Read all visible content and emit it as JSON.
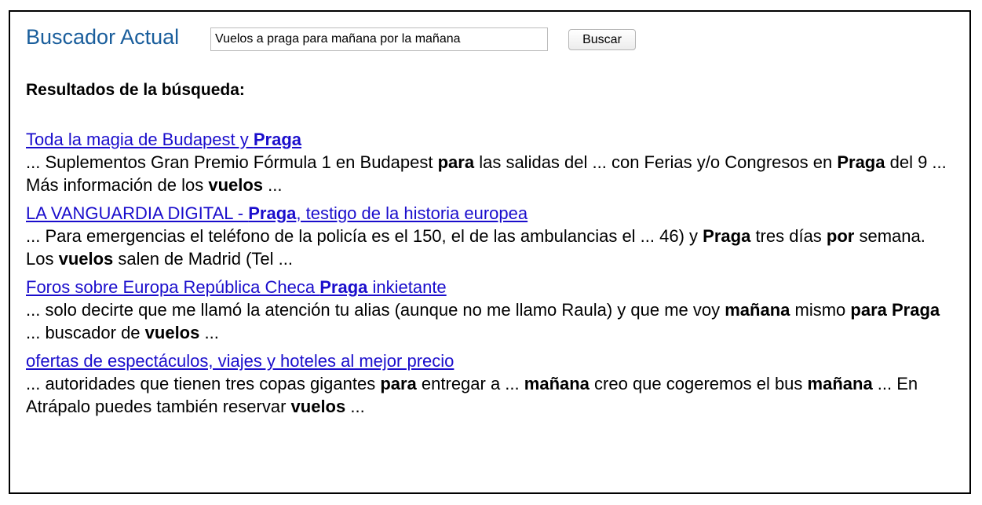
{
  "header": {
    "brand": "Buscador Actual",
    "search_value": "Vuelos a praga para mañana por la mañana",
    "search_button": "Buscar"
  },
  "results_heading": "Resultados de la búsqueda:",
  "results": [
    {
      "title": [
        {
          "text": "Toda la magia de Budapest y ",
          "bold": false
        },
        {
          "text": "Praga",
          "bold": true
        }
      ],
      "snippet": [
        {
          "text": "... Suplementos Gran Premio Fórmula 1 en Budapest ",
          "bold": false
        },
        {
          "text": "para",
          "bold": true
        },
        {
          "text": " las salidas del ... con Ferias y/o Congresos en ",
          "bold": false
        },
        {
          "text": "Praga",
          "bold": true
        },
        {
          "text": " del 9 ... Más información de los ",
          "bold": false
        },
        {
          "text": "vuelos",
          "bold": true
        },
        {
          "text": " ...",
          "bold": false
        }
      ]
    },
    {
      "title": [
        {
          "text": "LA VANGUARDIA DIGITAL - ",
          "bold": false
        },
        {
          "text": "Praga",
          "bold": true
        },
        {
          "text": ", testigo de la historia europea",
          "bold": false
        }
      ],
      "snippet": [
        {
          "text": "... Para emergencias el teléfono de la policía es el 150, el de las ambulancias el ... 46) y ",
          "bold": false
        },
        {
          "text": "Praga",
          "bold": true
        },
        {
          "text": " tres días ",
          "bold": false
        },
        {
          "text": "por",
          "bold": true
        },
        {
          "text": " semana. Los ",
          "bold": false
        },
        {
          "text": "vuelos",
          "bold": true
        },
        {
          "text": " salen de Madrid (Tel ...",
          "bold": false
        }
      ]
    },
    {
      "title": [
        {
          "text": "Foros sobre Europa República Checa ",
          "bold": false
        },
        {
          "text": "Praga",
          "bold": true
        },
        {
          "text": " inkietante",
          "bold": false
        }
      ],
      "snippet": [
        {
          "text": "... solo decirte que me llamó la atención tu alias (aunque no me llamo Raula) y que me voy ",
          "bold": false
        },
        {
          "text": "mañana",
          "bold": true
        },
        {
          "text": " mismo ",
          "bold": false
        },
        {
          "text": "para Praga",
          "bold": true
        },
        {
          "text": " ... buscador de ",
          "bold": false
        },
        {
          "text": "vuelos",
          "bold": true
        },
        {
          "text": " ...",
          "bold": false
        }
      ]
    },
    {
      "title": [
        {
          "text": "ofertas de espectáculos, viajes y hoteles al mejor precio",
          "bold": false
        }
      ],
      "snippet": [
        {
          "text": "... autoridades que tienen tres copas gigantes ",
          "bold": false
        },
        {
          "text": "para",
          "bold": true
        },
        {
          "text": " entregar a ... ",
          "bold": false
        },
        {
          "text": "mañana",
          "bold": true
        },
        {
          "text": " creo que cogeremos el bus ",
          "bold": false
        },
        {
          "text": "mañana",
          "bold": true
        },
        {
          "text": " ... En Atrápalo puedes también reservar ",
          "bold": false
        },
        {
          "text": "vuelos",
          "bold": true
        },
        {
          "text": " ...",
          "bold": false
        }
      ]
    }
  ]
}
